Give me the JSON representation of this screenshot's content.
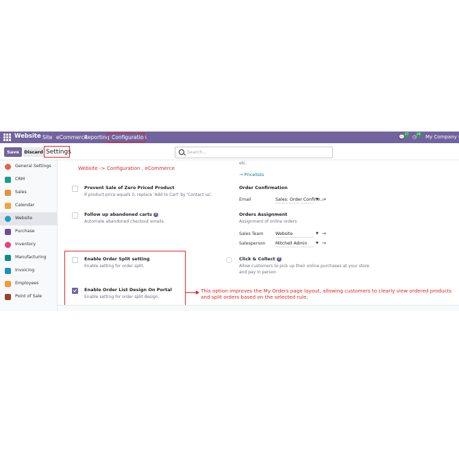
{
  "navbar": {
    "app": "Website",
    "menu": [
      "Site",
      "eCommerce",
      "Reporting",
      "Configuration"
    ],
    "messages_count": "27",
    "activity_count": "24",
    "company": "My Company (Sa"
  },
  "control": {
    "save_label": "Save",
    "discard_label": "Discard",
    "breadcrumb": "Settings",
    "search_placeholder": "Search..."
  },
  "sidebar": {
    "items": [
      {
        "label": "General Settings",
        "icon": "general-settings-icon",
        "color": "#e8624a"
      },
      {
        "label": "CRM",
        "icon": "crm-icon",
        "color": "#1a9d8f"
      },
      {
        "label": "Sales",
        "icon": "sales-icon",
        "color": "#e8913a"
      },
      {
        "label": "Calendar",
        "icon": "calendar-icon",
        "color": "#f0a23b"
      },
      {
        "label": "Website",
        "icon": "website-icon",
        "color": "#1d9bd1"
      },
      {
        "label": "Purchase",
        "icon": "purchase-icon",
        "color": "#714b9c"
      },
      {
        "label": "Inventory",
        "icon": "inventory-icon",
        "color": "#e0457b"
      },
      {
        "label": "Manufacturing",
        "icon": "manufacturing-icon",
        "color": "#0c8c8c"
      },
      {
        "label": "Invoicing",
        "icon": "invoicing-icon",
        "color": "#1890c4"
      },
      {
        "label": "Employees",
        "icon": "employees-icon",
        "color": "#f29b33"
      },
      {
        "label": "Point of Sale",
        "icon": "point-of-sale-icon",
        "color": "#9a3f2c"
      }
    ]
  },
  "settings": {
    "etc_text": "etc.",
    "pricelists_link": "→ Pricelists",
    "zero_price": {
      "title": "Prevent Sale of Zero Priced Product",
      "desc": "If product price equals 0, replace 'Add to Cart' by 'Contact us'."
    },
    "order_confirmation": {
      "title": "Order Confirmation",
      "email_label": "Email",
      "email_value": "Sales: Order Confirm..."
    },
    "abandoned": {
      "title": "Follow up abandoned carts",
      "desc": "Automate abandoned checkout emails."
    },
    "orders_assignment": {
      "title": "Orders Assignment",
      "desc": "Assignment of online orders",
      "team_label": "Sales Team",
      "team_value": "Website",
      "salesperson_label": "Salesperson",
      "salesperson_value": "Mitchell Admin"
    },
    "order_split": {
      "title": "Enable Order Split setting",
      "desc": "Enable setting for order split."
    },
    "click_collect": {
      "title": "Click & Collect",
      "desc1": "Allow customers to pick up their online purchases at your store",
      "desc2": "and pay in person"
    },
    "order_list_design": {
      "title": "Enable Order List Design On Portal",
      "desc": "Enable setting for order split design."
    }
  },
  "annotations": {
    "path_note": "Website -> Configuration , eCommerce",
    "explain_line1": "This option improves the My Orders page layout, allowing customers to clearly view ordered products",
    "explain_line2": "and split orders based on the selected rule.",
    "color": "#e02424"
  }
}
